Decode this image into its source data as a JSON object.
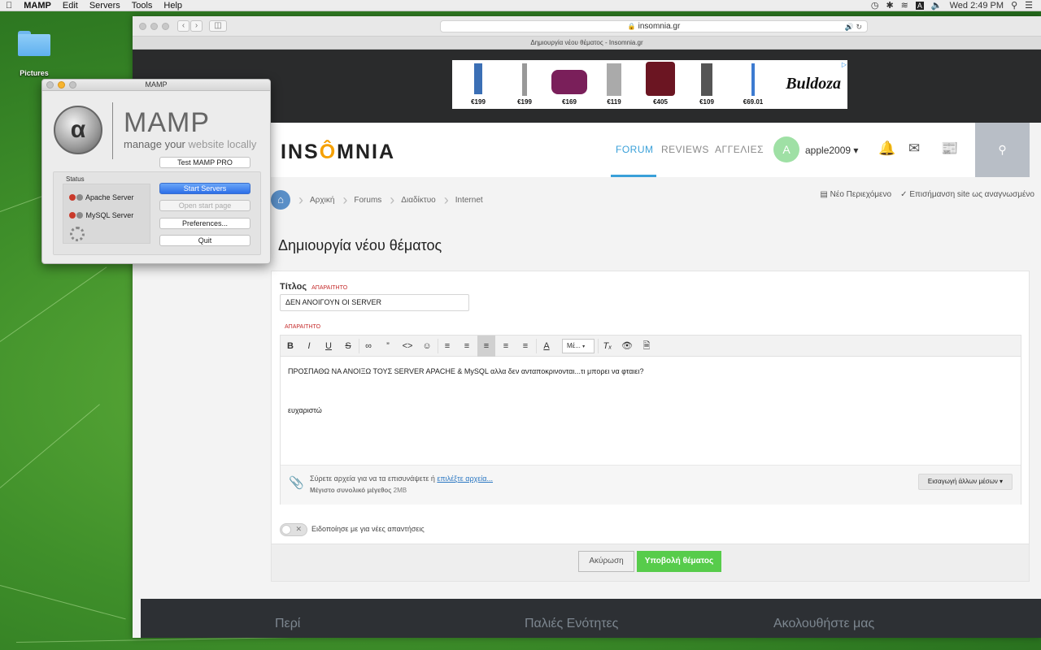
{
  "menubar": {
    "apple": "",
    "app": "MAMP",
    "items": [
      "Edit",
      "Servers",
      "Tools",
      "Help"
    ],
    "clock": "Wed 2:49 PM",
    "status_icons": [
      "time-machine-icon",
      "bluetooth-icon",
      "wifi-icon",
      "input-source-icon",
      "volume-icon",
      "spotlight-icon",
      "notification-center-icon"
    ]
  },
  "desktop": {
    "folder_label": "Pictures"
  },
  "browser": {
    "url": "insomnia.gr",
    "tab_title": "Δημιουργία νέου θέματος - Insomnia.gr"
  },
  "ad": {
    "prices": [
      "€199",
      "€199",
      "€169",
      "€119",
      "€405",
      "€109",
      "€69.01"
    ],
    "brand": "Buldoza"
  },
  "site": {
    "logo": {
      "part1": "INS",
      "o": "Ô",
      "part2": "MNIA"
    },
    "nav": [
      "FORUM",
      "REVIEWS",
      "ΑΓΓΕΛΙΕΣ"
    ],
    "avatar_letter": "A",
    "username": "apple2009",
    "breadcrumbs": [
      "Αρχική",
      "Forums",
      "Διαδίκτυο",
      "Internet"
    ],
    "new_content": "Νέο Περιεχόμενο",
    "mark_read": "Επισήμανση site ως αναγνωσμένο",
    "page_title": "Δημιουργία νέου θέματος",
    "form": {
      "title_label": "Τίτλος",
      "required": "ΑΠΑΡΑΙΤΗΤΟ",
      "title_value": "ΔΕΝ ΑΝΟΙΓΟΥΝ ΟΙ SERVER",
      "body_required": "ΑΠΑΡΑΙΤΗΤΟ",
      "font_select": "Mέ...",
      "body_line1": "ΠΡΟΣΠΑΘΩ ΝΑ ΑΝΟΙΞΩ ΤΟΥΣ SERVER APACHE & MySQL αλλα δεν ανταποκρινονται...τι μπορει να φταιει?",
      "body_line2": "ευχαριστώ",
      "attach_text": "Σύρετε αρχεία για να τα επισυνάψετε ή",
      "attach_link": "επιλέξτε αρχεία...",
      "attach_limit_label": "Μέγιστο συνολικό μέγεθος",
      "attach_limit_value": "2MB",
      "more_media": "Εισαγωγή άλλων μέσων ▾",
      "notify_label": "Ειδοποίησε με για νέες απαντήσεις",
      "cancel": "Ακύρωση",
      "submit": "Υποβολή θέματος"
    },
    "footer": [
      "Περί",
      "Παλιές Ενότητες",
      "Ακολουθήστε μας"
    ]
  },
  "mamp": {
    "window_title": "MAMP",
    "name": "MAMP",
    "tagline_a": "manage your",
    "tagline_b": "website locally",
    "test_pro": "Test MAMP PRO",
    "status_label": "Status",
    "servers": [
      "Apache Server",
      "MySQL Server"
    ],
    "start_servers": "Start Servers",
    "open_start_page": "Open start page",
    "preferences": "Preferences...",
    "quit": "Quit"
  }
}
